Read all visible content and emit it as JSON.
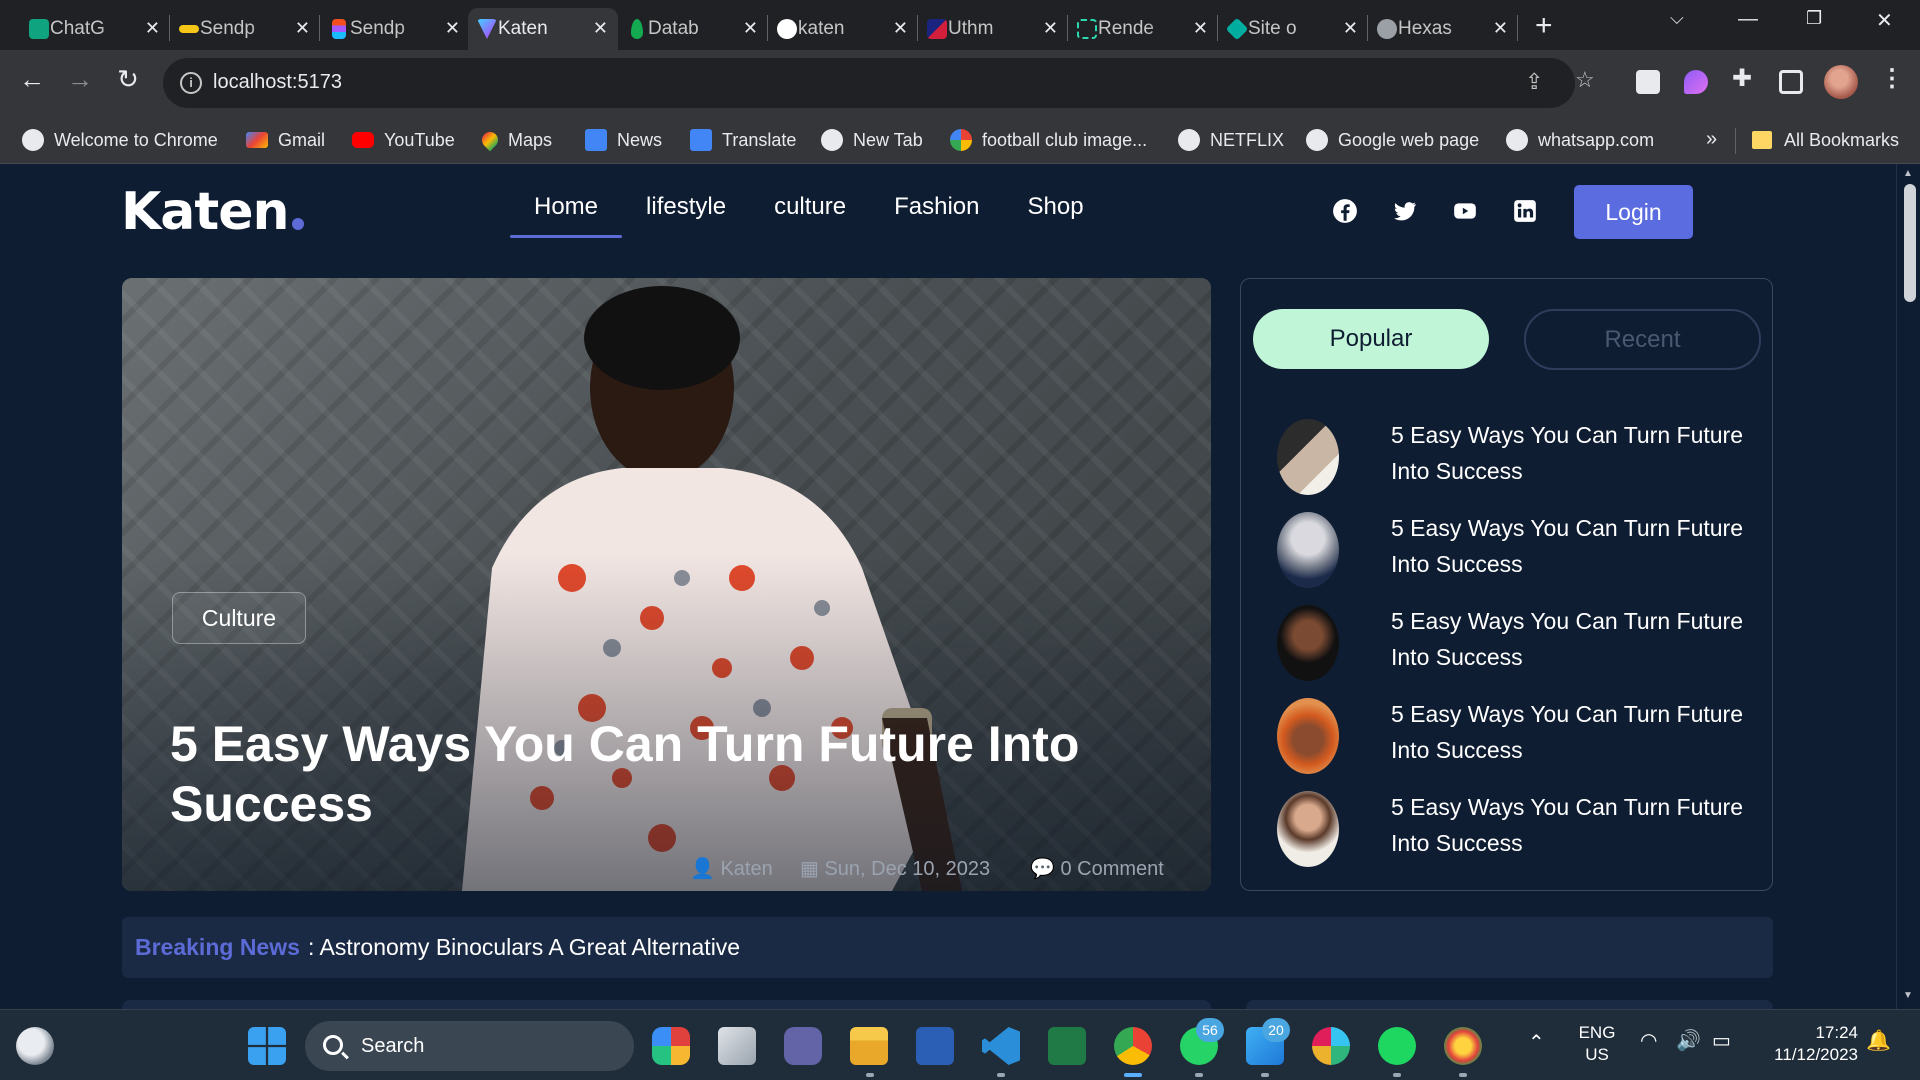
{
  "browser": {
    "tabs": [
      {
        "title": "ChatG",
        "favicon_color": "#10a37f"
      },
      {
        "title": "Sendp",
        "favicon_color": "#f5c518"
      },
      {
        "title": "Sendp",
        "favicon_color": "#f24e1e"
      },
      {
        "title": "Katen",
        "favicon_color": "#8c6dfd",
        "active": true
      },
      {
        "title": "Datab",
        "favicon_color": "#13aa52"
      },
      {
        "title": "katen",
        "favicon_color": "#000000"
      },
      {
        "title": "Uthm",
        "favicon_color": "#d21f3c"
      },
      {
        "title": "Rende",
        "favicon_color": "#2bd9b0"
      },
      {
        "title": "Site o",
        "favicon_color": "#00ad9f"
      },
      {
        "title": "Hexas",
        "favicon_color": "#9aa0a6"
      }
    ],
    "url": "localhost:5173",
    "bookmarks": [
      {
        "label": "Welcome to Chrome",
        "icon": "globe-icon",
        "color": "#e8eaed"
      },
      {
        "label": "Gmail",
        "icon": "gmail-icon",
        "color": "#ea4335"
      },
      {
        "label": "YouTube",
        "icon": "youtube-icon",
        "color": "#ff0000"
      },
      {
        "label": "Maps",
        "icon": "maps-icon",
        "color": "#34a853"
      },
      {
        "label": "News",
        "icon": "news-icon",
        "color": "#4285f4"
      },
      {
        "label": "Translate",
        "icon": "translate-icon",
        "color": "#4285f4"
      },
      {
        "label": "New Tab",
        "icon": "globe-icon",
        "color": "#e8eaed"
      },
      {
        "label": "football club image...",
        "icon": "google-icon",
        "color": "#4285f4"
      },
      {
        "label": "NETFLIX",
        "icon": "globe-icon",
        "color": "#e8eaed"
      },
      {
        "label": "Google web page",
        "icon": "globe-icon",
        "color": "#e8eaed"
      },
      {
        "label": "whatsapp.com",
        "icon": "globe-icon",
        "color": "#e8eaed"
      }
    ],
    "all_bookmarks": "All Bookmarks"
  },
  "site": {
    "logo": "Katen",
    "accent": "#5d6bd6",
    "nav": [
      "Home",
      "lifestyle",
      "culture",
      "Fashion",
      "Shop"
    ],
    "active_nav": "Home",
    "login_label": "Login",
    "social": [
      "facebook-icon",
      "twitter-icon",
      "youtube-icon",
      "linkedin-icon"
    ]
  },
  "hero": {
    "category": "Culture",
    "title": "5 Easy Ways You Can Turn Future Into Success",
    "author": "Katen",
    "date": "Sun, Dec 10, 2023",
    "comments": "0 Comment"
  },
  "sidebar": {
    "tab_popular": "Popular",
    "tab_recent": "Recent",
    "posts": [
      {
        "title": "5 Easy Ways You Can Turn Future Into Success",
        "thumb": [
          "#2c2c2c",
          "#c9b6a5"
        ]
      },
      {
        "title": "5 Easy Ways You Can Turn Future Into Success",
        "thumb": [
          "#1c2a4a",
          "#d9d9df"
        ]
      },
      {
        "title": "5 Easy Ways You Can Turn Future Into Success",
        "thumb": [
          "#111111",
          "#7a4a32"
        ]
      },
      {
        "title": "5 Easy Ways You Can Turn Future Into Success",
        "thumb": [
          "#d35a1f",
          "#8a4b2e"
        ]
      },
      {
        "title": "5 Easy Ways You Can Turn Future Into Success",
        "thumb": [
          "#f0ece6",
          "#5b3a2a"
        ]
      }
    ]
  },
  "breaking": {
    "label": "Breaking News",
    "text": ": Astronomy Binoculars A Great Alternative"
  },
  "taskbar": {
    "search_label": "Search",
    "whatsapp_badge": "56",
    "mail_badge": "20",
    "lang_line1": "ENG",
    "lang_line2": "US",
    "time": "17:24",
    "date": "11/12/2023"
  }
}
